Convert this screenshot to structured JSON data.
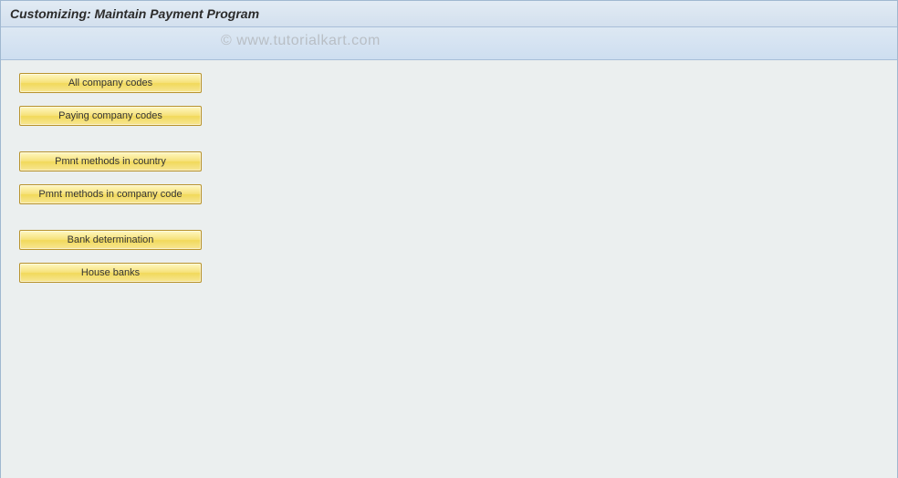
{
  "header": {
    "title": "Customizing: Maintain Payment Program"
  },
  "watermark": "© www.tutorialkart.com",
  "buttons": {
    "group1": {
      "all_company_codes": "All company codes",
      "paying_company_codes": "Paying company codes"
    },
    "group2": {
      "pmnt_methods_country": "Pmnt methods in country",
      "pmnt_methods_company": "Pmnt methods in company code"
    },
    "group3": {
      "bank_determination": "Bank determination",
      "house_banks": "House banks"
    }
  }
}
